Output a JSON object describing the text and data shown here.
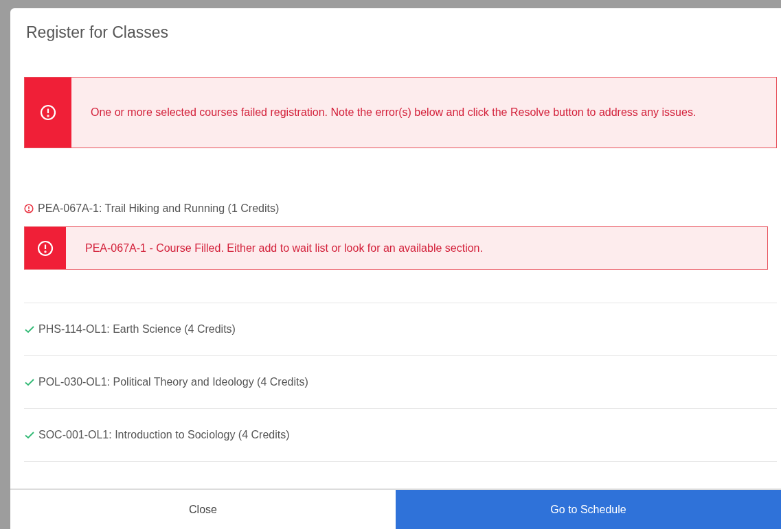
{
  "dialog": {
    "title": "Register for Classes",
    "alert": {
      "message": "One or more selected courses failed registration. Note the error(s) below and click the Resolve button to address any issues."
    },
    "courses": [
      {
        "label": "PEA-067A-1: Trail Hiking and Running (1 Credits)",
        "kind": "error",
        "error": "PEA-067A-1 - Course Filled. Either add to wait list or look for an available section."
      },
      {
        "label": "PHS-114-OL1: Earth Science (4 Credits)",
        "kind": "success"
      },
      {
        "label": "POL-030-OL1: Political Theory and Ideology (4 Credits)",
        "kind": "success"
      },
      {
        "label": "SOC-001-OL1: Introduction to Sociology (4 Credits)",
        "kind": "success"
      }
    ],
    "buttons": [
      {
        "label": "Close",
        "kind": "secondary"
      },
      {
        "label": "Go to Schedule",
        "kind": "primary"
      }
    ]
  }
}
